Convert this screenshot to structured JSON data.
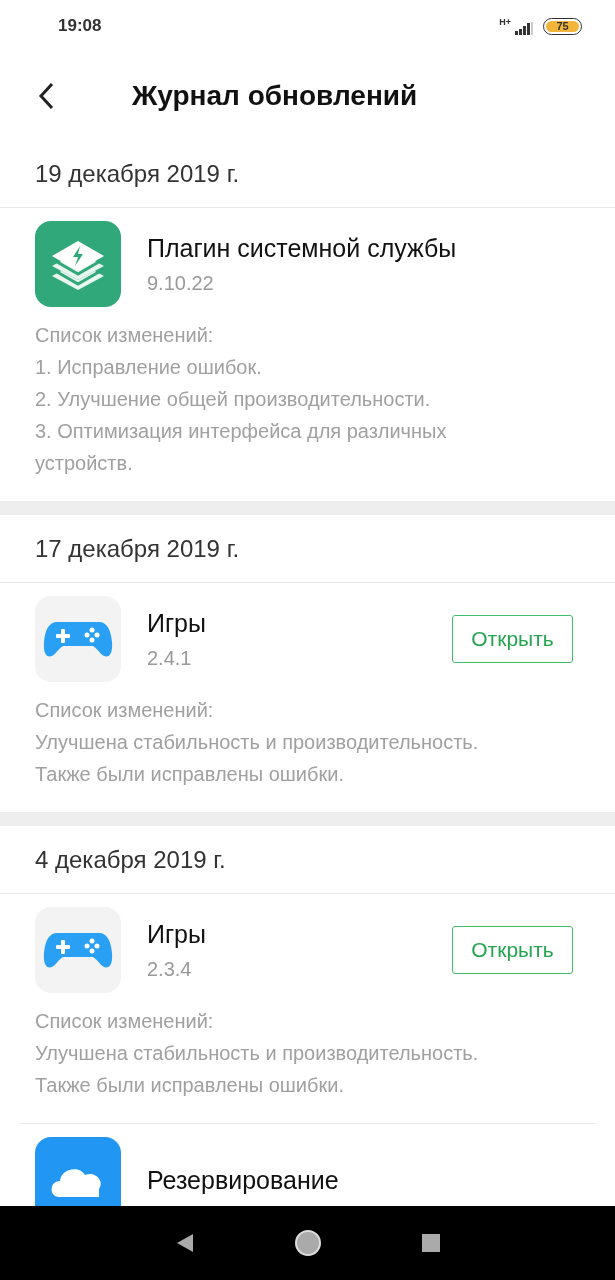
{
  "status_bar": {
    "time": "19:08",
    "network": "H+",
    "battery": "75"
  },
  "header": {
    "title": "Журнал обновлений"
  },
  "sections": [
    {
      "date": "19 декабря 2019 г.",
      "apps": [
        {
          "kind": "plugin",
          "name": "Плагин системной службы",
          "version": "9.10.22",
          "changelog_title": "Список изменений:",
          "changes": [
            "1. Исправление ошибок.",
            "2. Улучшение общей производительности.",
            "3. Оптимизация интерфейса для различных устройств."
          ]
        }
      ]
    },
    {
      "date": "17 декабря 2019 г.",
      "apps": [
        {
          "kind": "gamepad",
          "name": "Игры",
          "version": "2.4.1",
          "button": "Открыть",
          "changelog_title": "Список изменений:",
          "changes": [
            "Улучшена стабильность и производительность.",
            "Также были исправлены ошибки."
          ]
        }
      ]
    },
    {
      "date": "4 декабря 2019 г.",
      "apps": [
        {
          "kind": "gamepad",
          "name": "Игры",
          "version": "2.3.4",
          "button": "Открыть",
          "changelog_title": "Список изменений:",
          "changes": [
            "Улучшена стабильность и производительность.",
            "Также были исправлены ошибки."
          ]
        },
        {
          "kind": "cloud",
          "name": "Резервирование"
        }
      ]
    }
  ]
}
